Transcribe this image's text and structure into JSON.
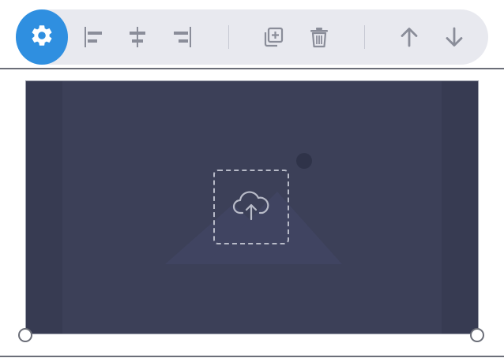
{
  "toolbar": {
    "settings_icon": "gear-icon",
    "align_icons": [
      "align-left-icon",
      "align-center-icon",
      "align-right-icon"
    ],
    "edit_icons": [
      "duplicate-icon",
      "trash-icon"
    ],
    "order_icons": [
      "arrow-up-icon",
      "arrow-down-icon"
    ]
  },
  "image_block": {
    "state": "empty",
    "upload_icon": "cloud-upload-icon",
    "placeholder_icon": "image-placeholder-icon"
  },
  "colors": {
    "accent": "#2f8fe0",
    "toolbar_bg": "#e8e9ef",
    "icon_gray": "#8a8d99",
    "image_bg": "#3c4058",
    "image_side": "#373b52"
  }
}
